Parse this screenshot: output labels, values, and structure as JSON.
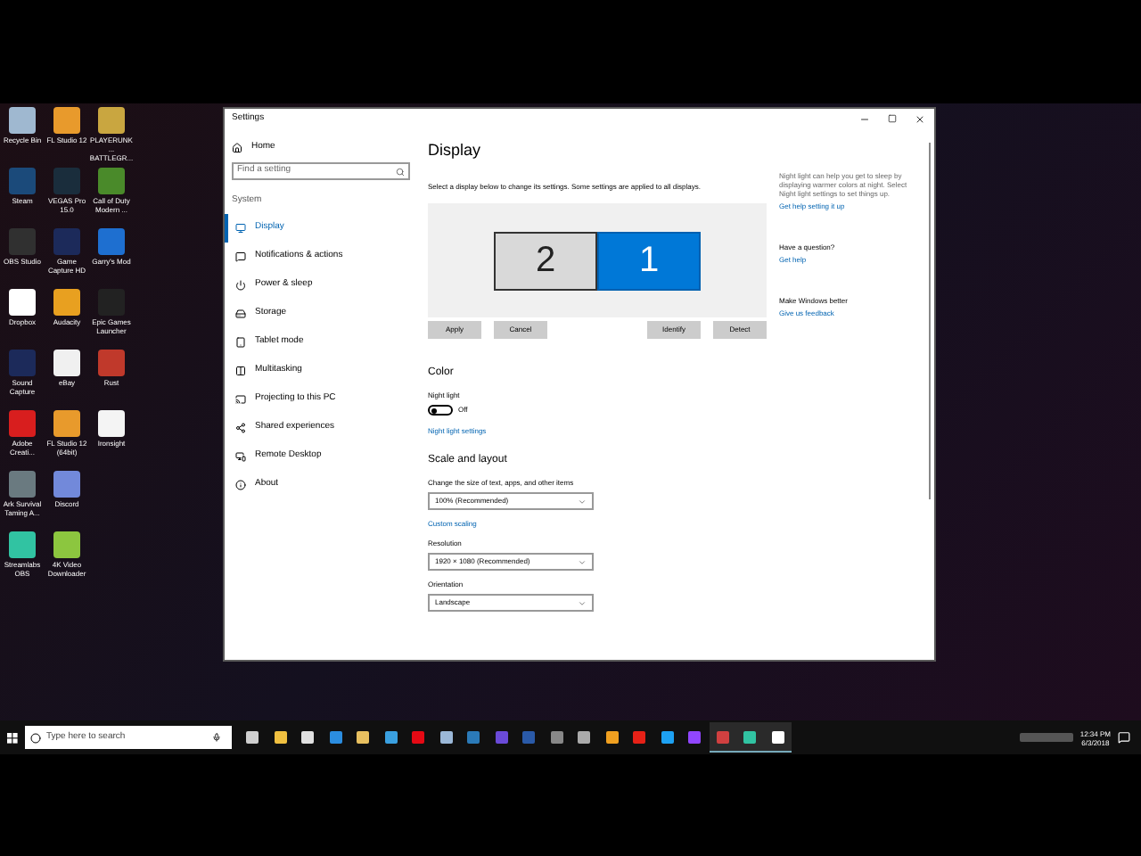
{
  "desktop_icons": [
    {
      "label": "Recycle Bin",
      "color": "#9fb8d0"
    },
    {
      "label": "Steam",
      "color": "#1b4a7a"
    },
    {
      "label": "OBS Studio",
      "color": "#303030"
    },
    {
      "label": "Dropbox",
      "color": "#ffffff"
    },
    {
      "label": "Sound Capture",
      "color": "#1c2a5a"
    },
    {
      "label": "Adobe Creati...",
      "color": "#d81e1e"
    },
    {
      "label": "Ark Survival Taming A...",
      "color": "#6a7a80"
    },
    {
      "label": "Streamlabs OBS",
      "color": "#31c3a2"
    },
    {
      "label": "FL Studio 12",
      "color": "#e89a2c"
    },
    {
      "label": "VEGAS Pro 15.0",
      "color": "#1a2d3c"
    },
    {
      "label": "Game Capture HD",
      "color": "#1c2a5a"
    },
    {
      "label": "Audacity",
      "color": "#e8a020"
    },
    {
      "label": "eBay",
      "color": "#f0f0f0"
    },
    {
      "label": "FL Studio 12 (64bit)",
      "color": "#e89a2c"
    },
    {
      "label": "Discord",
      "color": "#7289da"
    },
    {
      "label": "4K Video Downloader",
      "color": "#8cc63f"
    },
    {
      "label": "PLAYERUNK... BATTLEGR...",
      "color": "#c9a640"
    },
    {
      "label": "Call of Duty Modern ...",
      "color": "#4a8a2a"
    },
    {
      "label": "Garry's Mod",
      "color": "#1e6fd0"
    },
    {
      "label": "Epic Games Launcher",
      "color": "#222222"
    },
    {
      "label": "Rust",
      "color": "#c0392b"
    },
    {
      "label": "Ironsight",
      "color": "#f4f4f4"
    }
  ],
  "settings": {
    "title": "Settings",
    "home": "Home",
    "search": {
      "placeholder": "Find a setting"
    },
    "section": "System",
    "nav": [
      {
        "label": "Display",
        "selected": true
      },
      {
        "label": "Notifications & actions",
        "selected": false
      },
      {
        "label": "Power & sleep",
        "selected": false
      },
      {
        "label": "Storage",
        "selected": false
      },
      {
        "label": "Tablet mode",
        "selected": false
      },
      {
        "label": "Multitasking",
        "selected": false
      },
      {
        "label": "Projecting to this PC",
        "selected": false
      },
      {
        "label": "Shared experiences",
        "selected": false
      },
      {
        "label": "Remote Desktop",
        "selected": false
      },
      {
        "label": "About",
        "selected": false
      }
    ],
    "page_title": "Display",
    "description": "Select a display below to change its settings. Some settings are applied to all displays.",
    "monitors": [
      {
        "label": "2",
        "selected": false
      },
      {
        "label": "1",
        "selected": true
      }
    ],
    "buttons_left": [
      "Apply",
      "Cancel"
    ],
    "buttons_right": [
      "Identify",
      "Detect"
    ],
    "color_heading": "Color",
    "night_light_label": "Night light",
    "night_light": {
      "on": false,
      "text": "Off"
    },
    "night_light_link": "Night light settings",
    "scale_heading": "Scale and layout",
    "fields": [
      {
        "label": "Change the size of text, apps, and other items",
        "value": "100% (Recommended)",
        "link": "Custom scaling"
      },
      {
        "label": "Resolution",
        "value": "1920 × 1080 (Recommended)"
      },
      {
        "label": "Orientation",
        "value": "Landscape"
      }
    ],
    "aside": [
      {
        "text": "Night light can help you get to sleep by displaying warmer colors at night. Select Night light settings to set things up.",
        "link": "Get help setting it up"
      },
      {
        "text": "Have a question?",
        "link": "Get help"
      },
      {
        "text": "Make Windows better",
        "link": "Give us feedback"
      }
    ]
  },
  "taskbar": {
    "search_placeholder": "Type here to search",
    "apps": [
      {
        "color": "#cfcfcf",
        "running": false
      },
      {
        "color": "#f0c040",
        "running": false
      },
      {
        "color": "#e0e0e0",
        "running": false
      },
      {
        "color": "#2b8de0",
        "running": false
      },
      {
        "color": "#e8c060",
        "running": false
      },
      {
        "color": "#3aa0e0",
        "running": false
      },
      {
        "color": "#e50914",
        "running": false
      },
      {
        "color": "#9bb8d8",
        "running": false
      },
      {
        "color": "#2b7ab8",
        "running": false
      },
      {
        "color": "#6a4ad8",
        "running": false
      },
      {
        "color": "#2a5aa8",
        "running": false
      },
      {
        "color": "#888888",
        "running": false
      },
      {
        "color": "#aaaaaa",
        "running": false
      },
      {
        "color": "#f0a020",
        "running": false
      },
      {
        "color": "#e62117",
        "running": false
      },
      {
        "color": "#1da1f2",
        "running": false
      },
      {
        "color": "#9146ff",
        "running": false
      },
      {
        "color": "#d04040",
        "running": true
      },
      {
        "color": "#31c3a2",
        "running": true
      },
      {
        "color": "#ffffff",
        "running": true
      }
    ],
    "time": "12:34 PM",
    "date": "6/3/2018"
  }
}
